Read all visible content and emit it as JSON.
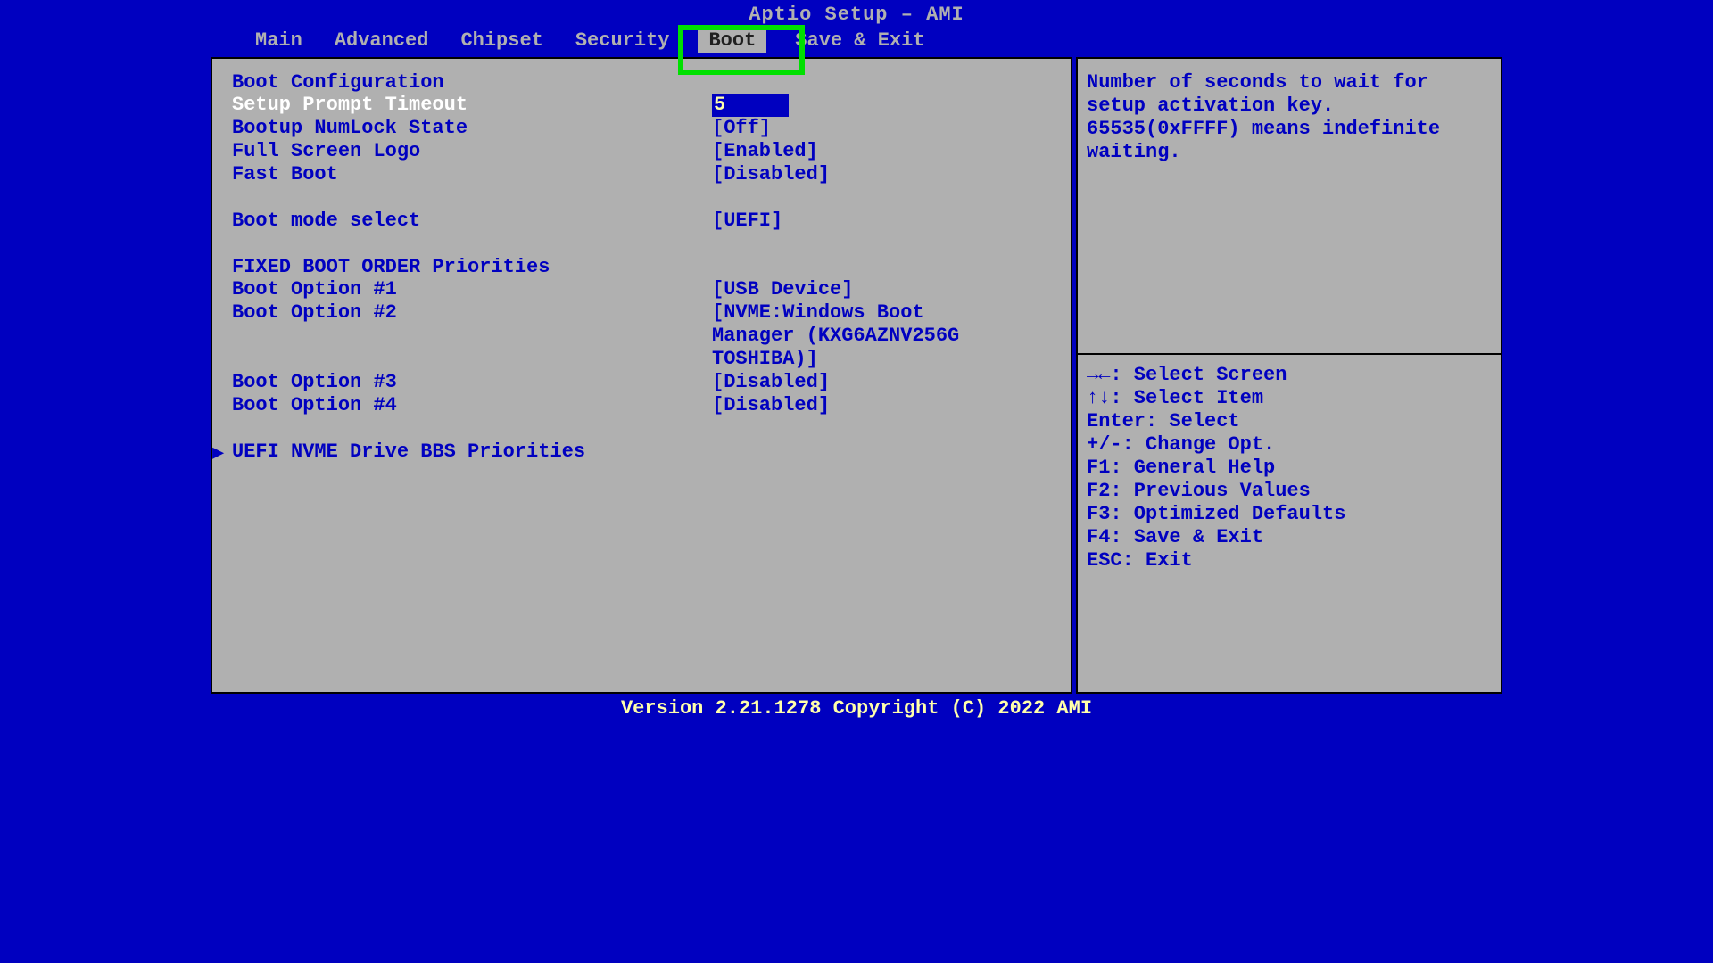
{
  "title": "Aptio Setup – AMI",
  "tabs": [
    "Main",
    "Advanced",
    "Chipset",
    "Security",
    "Boot",
    "Save & Exit"
  ],
  "selected_tab_index": 4,
  "main": {
    "section1_header": "Boot Configuration",
    "options": {
      "setup_prompt_timeout": {
        "label": "Setup Prompt Timeout",
        "value": "5",
        "selected": true
      },
      "bootup_numlock": {
        "label": "Bootup NumLock State",
        "value": "[Off]"
      },
      "full_screen_logo": {
        "label": "Full Screen Logo",
        "value": "[Enabled]"
      },
      "fast_boot": {
        "label": "Fast Boot",
        "value": "[Disabled]"
      },
      "boot_mode_select": {
        "label": "Boot mode select",
        "value": "[UEFI]"
      }
    },
    "section2_header": "FIXED BOOT ORDER Priorities",
    "boot_order": [
      {
        "label": "Boot Option #1",
        "value": "[USB Device]"
      },
      {
        "label": "Boot Option #2",
        "value": "[NVME:Windows Boot Manager (KXG6AZNV256G TOSHIBA)]"
      },
      {
        "label": "Boot Option #3",
        "value": "[Disabled]"
      },
      {
        "label": "Boot Option #4",
        "value": "[Disabled]"
      }
    ],
    "submenu": "UEFI NVME Drive BBS Priorities"
  },
  "help": {
    "description": "Number of seconds to wait for setup activation key. 65535(0xFFFF) means indefinite waiting.",
    "keys": [
      "→←: Select Screen",
      "↑↓: Select Item",
      "Enter: Select",
      "+/-: Change Opt.",
      "F1: General Help",
      "F2: Previous Values",
      "F3: Optimized Defaults",
      "F4: Save & Exit",
      "ESC: Exit"
    ]
  },
  "footer": "Version 2.21.1278 Copyright (C) 2022 AMI"
}
